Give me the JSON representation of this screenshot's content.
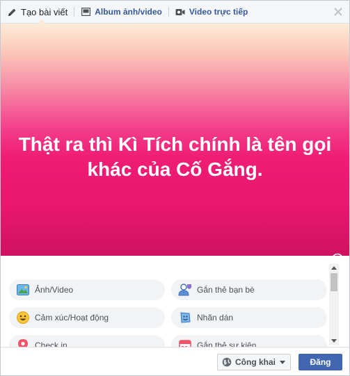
{
  "tabs": [
    {
      "label": "Tạo bài viết",
      "icon": "pencil-icon"
    },
    {
      "label": "Album ảnh/video",
      "icon": "photo-album-icon"
    },
    {
      "label": "Video trực tiếp",
      "icon": "live-video-icon"
    }
  ],
  "composer": {
    "text": "Thật ra thì Kì Tích chính là tên gọi khác của Cố Gắng.",
    "text_color": "#ffffff"
  },
  "swatches": [
    {
      "name": "white",
      "bg": "#ededed"
    },
    {
      "name": "rainbow",
      "bg": "linear-gradient(135deg,#7b5cf3,#44c3e5,#f2b33e)"
    },
    {
      "name": "pink-selected",
      "bg": "linear-gradient(180deg,#fbd3c3,#ef1c74)"
    },
    {
      "name": "blue-pattern",
      "bg": "linear-gradient(135deg,#5a8de6,#c06ad4)"
    },
    {
      "name": "purple-heart",
      "bg": "#5a0a55"
    },
    {
      "name": "sky",
      "bg": "linear-gradient(180deg,#8fbdf5,#c4a4e6)"
    },
    {
      "name": "light-blue",
      "bg": "#bfe6f5"
    },
    {
      "name": "magenta",
      "bg": "#c600ff"
    },
    {
      "name": "crimson",
      "bg": "#e0003a"
    },
    {
      "name": "black",
      "bg": "#111111"
    },
    {
      "name": "violet-gradient",
      "bg": "linear-gradient(135deg,#2c1f8a,#d33bc5)"
    },
    {
      "name": "purple-pink",
      "bg": "linear-gradient(135deg,#8d3bf5,#f04bd0)"
    },
    {
      "name": "orange-gradient",
      "bg": "linear-gradient(180deg,#ffb02e,#f23a67)"
    },
    {
      "name": "dark-gray",
      "bg": "linear-gradient(135deg,#444,#111)"
    },
    {
      "name": "starry-purple",
      "bg": "#3a1a4a"
    }
  ],
  "actions": [
    {
      "label": "Ảnh/Video",
      "icon": "photo-icon"
    },
    {
      "label": "Gắn thẻ bạn bè",
      "icon": "tag-friends-icon"
    },
    {
      "label": "Cảm xúc/Hoạt động",
      "icon": "smiley-icon"
    },
    {
      "label": "Nhãn dán",
      "icon": "sticker-icon"
    },
    {
      "label": "Check in",
      "icon": "location-pin-icon"
    },
    {
      "label": "Gắn thẻ sự kiện",
      "icon": "event-icon"
    }
  ],
  "footer": {
    "privacy": "Công khai",
    "post_button": "Đăng"
  },
  "colors": {
    "accent": "#4267b2",
    "link": "#365899"
  }
}
